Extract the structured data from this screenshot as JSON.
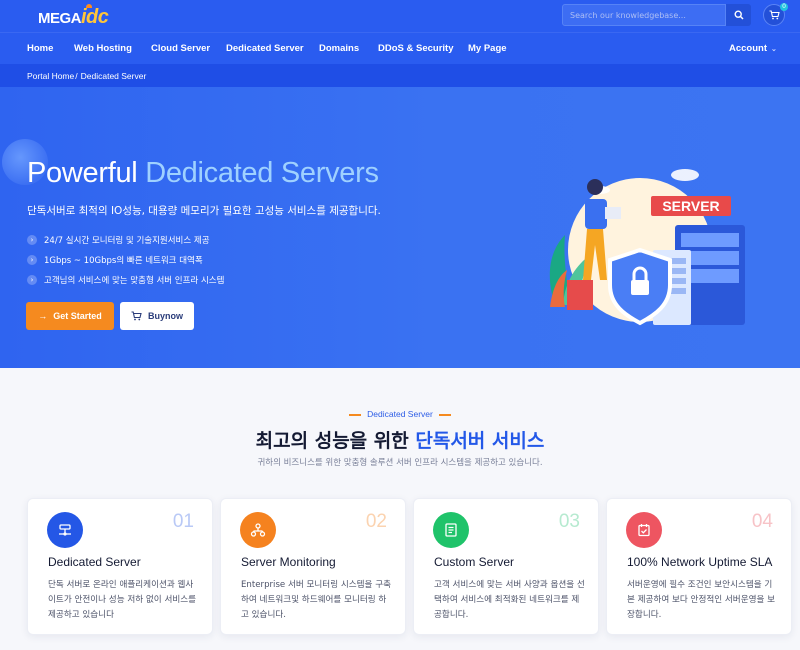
{
  "header": {
    "logo_main": "MEGA",
    "logo_accent": "idc",
    "search_placeholder": "Search our knowledgebase...",
    "cart_count": "0"
  },
  "nav": {
    "items": [
      "Home",
      "Web Hosting",
      "Cloud Server",
      "Dedicated Server",
      "Domains",
      "DDoS & Security",
      "My Page"
    ],
    "account": "Account"
  },
  "breadcrumb": {
    "home": "Portal Home",
    "current": "Dedicated Server"
  },
  "hero": {
    "title_plain": "Powerful",
    "title_accent": "Dedicated Servers",
    "subtitle": "단독서버로 최적의 IO성능, 대용량 메모리가 필요한 고성능 서비스를 제공합니다.",
    "features": [
      "24/7 실시간 모니터링 및 기술지원서비스 제공",
      "1Gbps ~ 10Gbps의 빠른 네트워크 대역폭",
      "고객님의 서비스에 맞는 맞춤형 서버 인프라 시스템"
    ],
    "btn_start": "Get Started",
    "btn_buy": "Buynow",
    "illustration_label": "SERVER"
  },
  "section": {
    "tag": "Dedicated Server",
    "title_plain": "최고의 성능을 위한",
    "title_accent": "단독서버 서비스",
    "subtitle": "귀하의 비즈니스를 위한 맞춤형 솔루션 서버 인프라 시스템을 제공하고 있습니다."
  },
  "cards": [
    {
      "num": "01",
      "title": "Dedicated Server",
      "desc": "단독 서버로 온라인 애플리케이션과 웹사이트가 안전이나 성능 저하 없이 서비스를 제공하고 있습니다",
      "icon": "server-icon",
      "color": "#2457e6",
      "num_color": "#b9c9f6"
    },
    {
      "num": "02",
      "title": "Server Monitoring",
      "desc": "Enterprise 서버 모니터링 시스템을 구축하여 네트워크및 하드웨어를 모니터링 하고 있습니다.",
      "icon": "network-icon",
      "color": "#f5821f",
      "num_color": "#fbd3b0"
    },
    {
      "num": "03",
      "title": "Custom Server",
      "desc": "고객 서비스에 맞는 서버 사양과 옵션을 선택하여 서비스에 최적화된 네트워크를 제공합니다.",
      "icon": "document-icon",
      "color": "#1fc36a",
      "num_color": "#b6ead0"
    },
    {
      "num": "04",
      "title": "100% Network Uptime SLA",
      "desc": "서버운영에 필수 조건인 보안시스템을 기본 제공하여 보다 안정적인 서버운영을 보장합니다.",
      "icon": "check-calendar-icon",
      "color": "#ee5561",
      "num_color": "#f7c3c7"
    }
  ]
}
